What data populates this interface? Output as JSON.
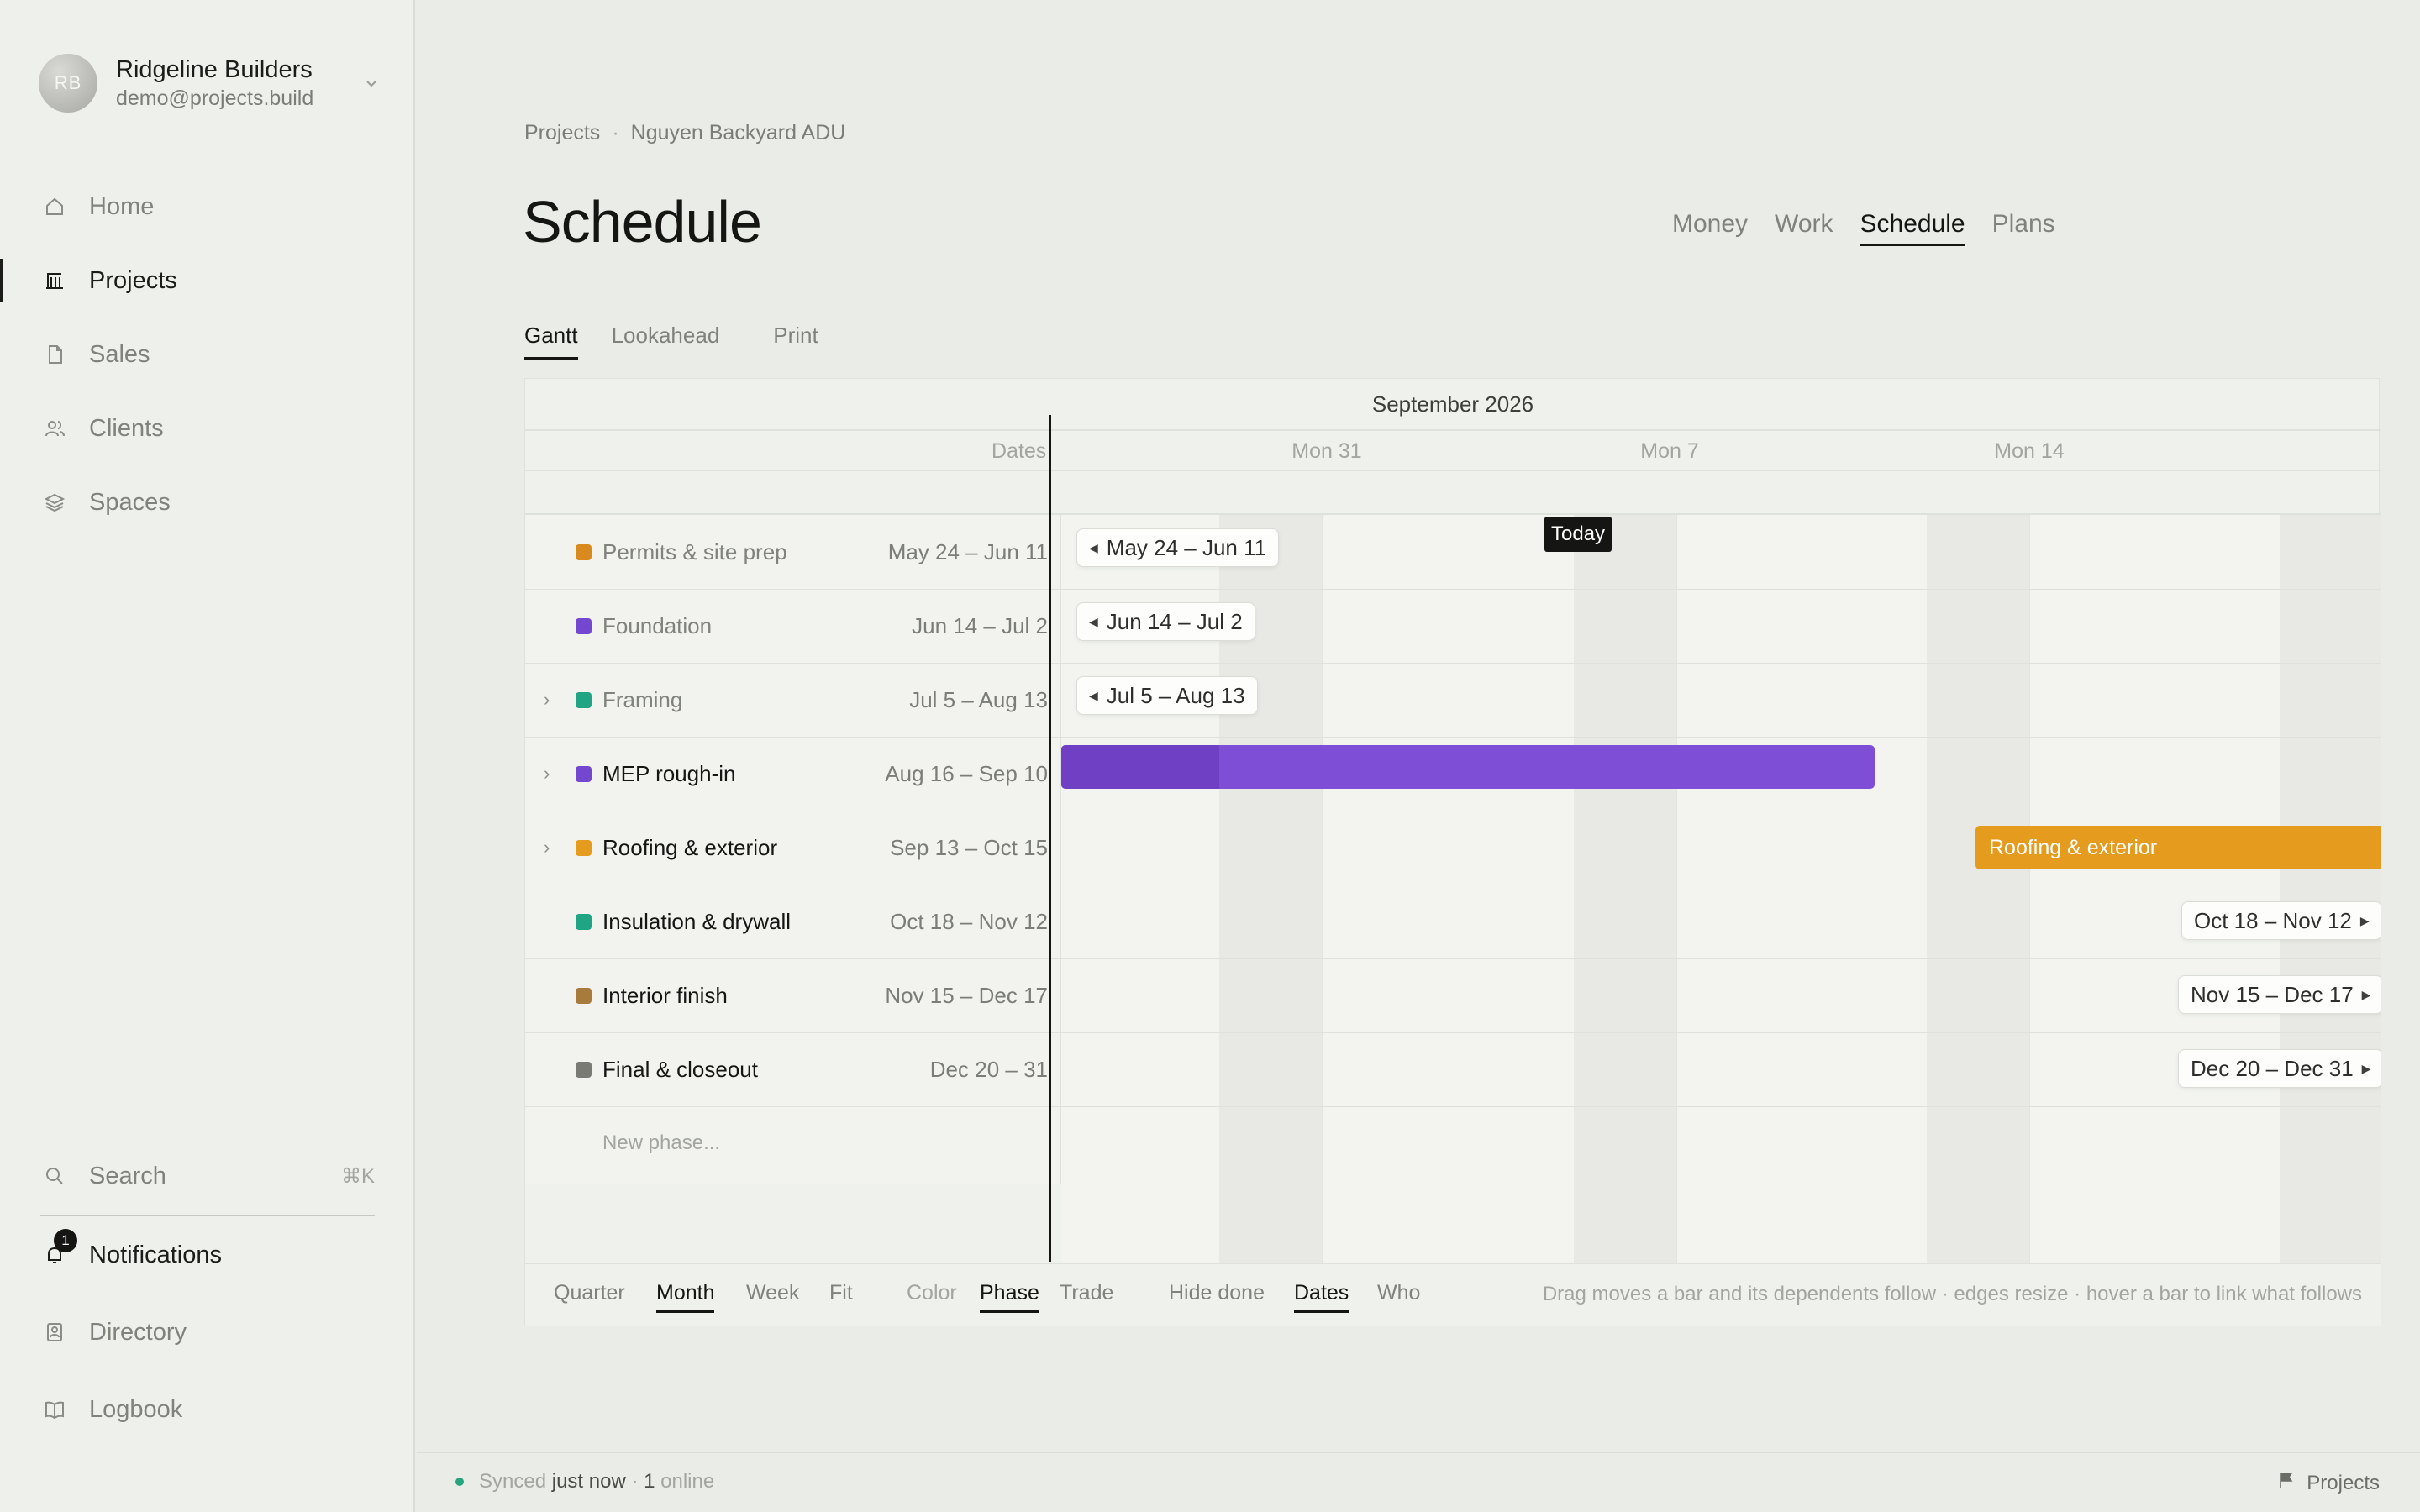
{
  "account": {
    "initials": "RB",
    "name": "Ridgeline Builders",
    "email": "demo@projects.build"
  },
  "nav": [
    {
      "label": "Home",
      "icon": "home-icon"
    },
    {
      "label": "Projects",
      "icon": "projects-icon",
      "active": true
    },
    {
      "label": "Sales",
      "icon": "document-icon"
    },
    {
      "label": "Clients",
      "icon": "people-icon"
    },
    {
      "label": "Spaces",
      "icon": "layers-icon"
    }
  ],
  "sidebar_bottom": {
    "search_label": "Search",
    "search_shortcut": "⌘K",
    "notifications_label": "Notifications",
    "notifications_count": "1",
    "directory_label": "Directory",
    "logbook_label": "Logbook"
  },
  "breadcrumb": {
    "root": "Projects",
    "sep": "·",
    "current": "Nguyen Backyard ADU"
  },
  "page_title": "Schedule",
  "top_tabs": [
    "Money",
    "Work",
    "Schedule",
    "Plans"
  ],
  "sub_tabs": [
    "Gantt",
    "Lookahead",
    "Print"
  ],
  "gantt": {
    "month": "September 2026",
    "dates_header": "Dates",
    "day_labels": [
      "Mon 31",
      "Mon 7",
      "Mon 14"
    ],
    "today_label": "Today",
    "phases": [
      {
        "name": "Permits & site prep",
        "dates": "May 24 – Jun 11",
        "color": "#d98a1f",
        "expandable": false
      },
      {
        "name": "Foundation",
        "dates": "Jun 14 – Jul 2",
        "color": "#7447d0",
        "expandable": false
      },
      {
        "name": "Framing",
        "dates": "Jul 5 – Aug 13",
        "color": "#1fa583",
        "expandable": true
      },
      {
        "name": "MEP rough-in",
        "dates": "Aug 16 – Sep 10",
        "color": "#7447d0",
        "expandable": true
      },
      {
        "name": "Roofing & exterior",
        "dates": "Sep 13 – Oct 15",
        "color": "#e59c1e",
        "expandable": true
      },
      {
        "name": "Insulation & drywall",
        "dates": "Oct 18 – Nov 12",
        "color": "#1fa583",
        "expandable": false
      },
      {
        "name": "Interior finish",
        "dates": "Nov 15 – Dec 17",
        "color": "#a87a3b",
        "expandable": false
      },
      {
        "name": "Final & closeout",
        "dates": "Dec 20 – 31",
        "color": "#7a7a74",
        "expandable": false
      }
    ],
    "pills_left": [
      "May 24 – Jun 11",
      "Jun 14 – Jul 2",
      "Jul 5 – Aug 13"
    ],
    "pills_right": [
      "Oct 18 – Nov 12",
      "Nov 15 – Dec 17",
      "Dec 20 – Dec 31"
    ],
    "roof_bar_label": "Roofing & exterior",
    "new_phase_placeholder": "New phase..."
  },
  "toolbar": {
    "zoom": [
      "Quarter",
      "Month",
      "Week",
      "Fit"
    ],
    "color_label": "Color",
    "color_options": [
      "Phase",
      "Trade"
    ],
    "toggles": [
      "Hide done",
      "Dates",
      "Who"
    ],
    "hint": "Drag moves a bar and its dependents follow · edges resize · hover a bar to link what follows"
  },
  "footer": {
    "synced": "Synced",
    "just_now": "just now",
    "sep": "·",
    "count": "1",
    "online": "online",
    "right_label": "Projects"
  }
}
